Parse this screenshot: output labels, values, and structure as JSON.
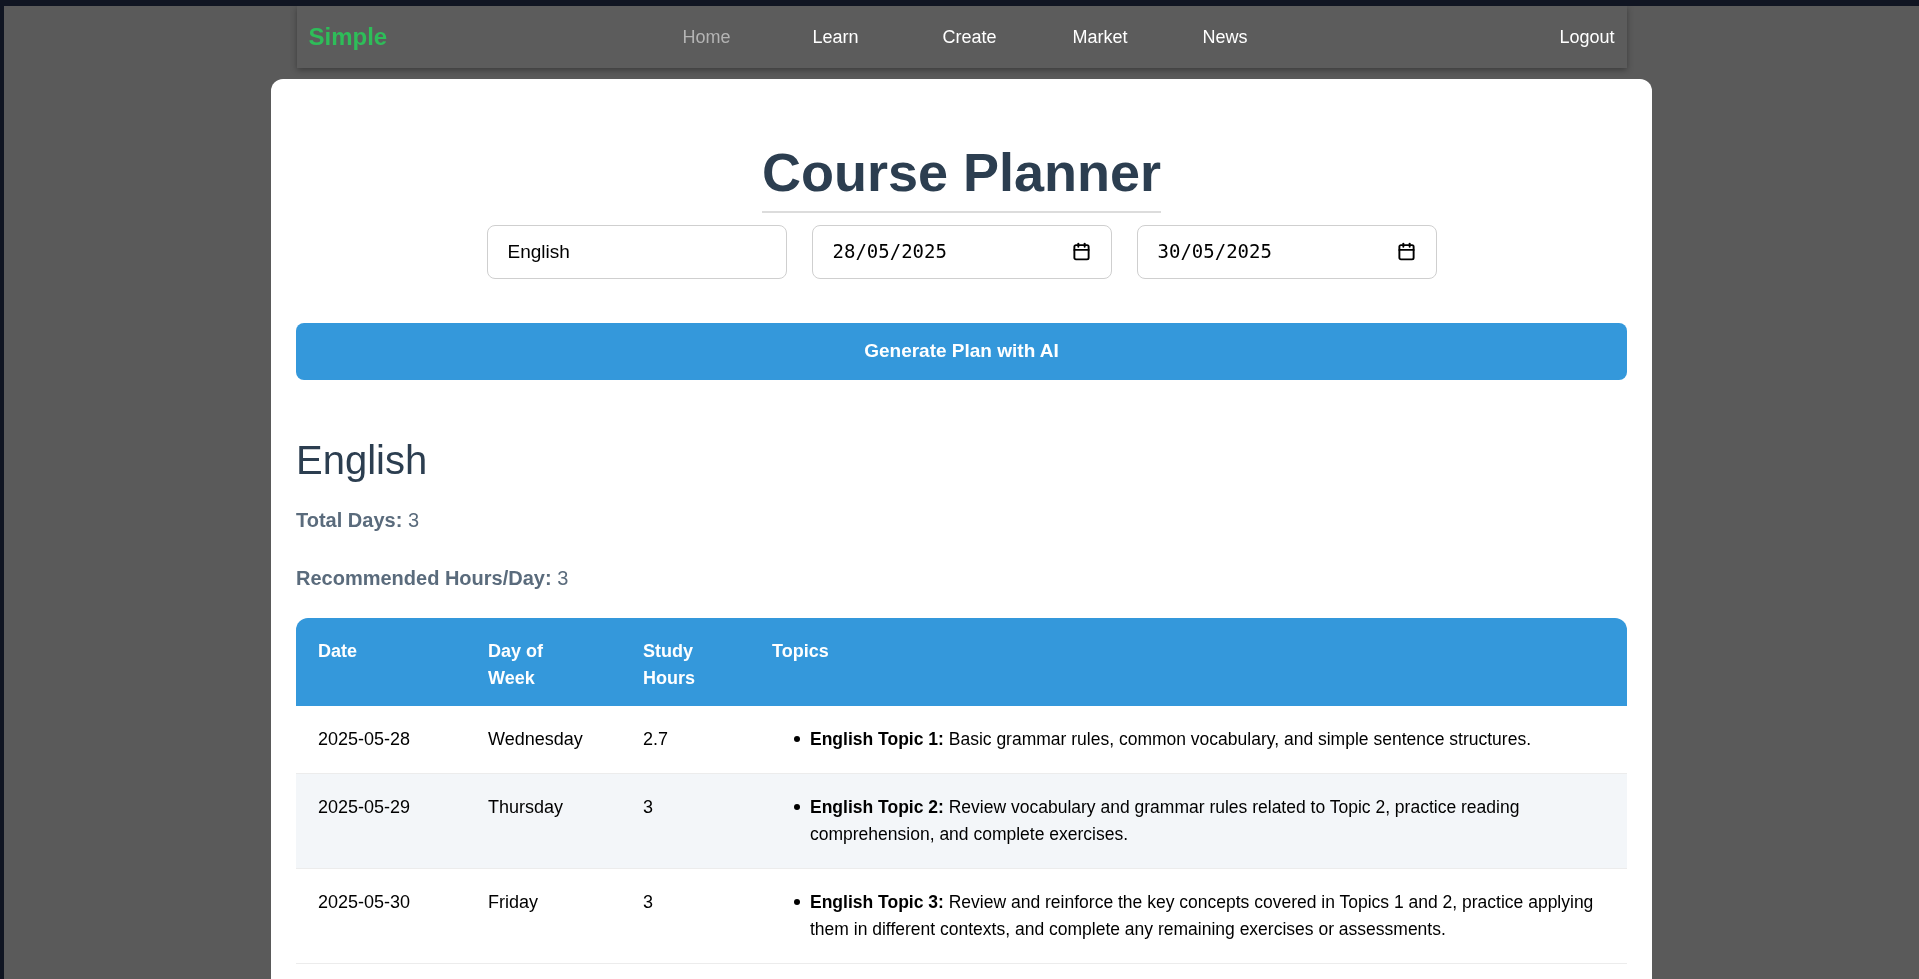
{
  "navbar": {
    "logo": "Simple",
    "links": [
      {
        "label": "Home",
        "selected": true
      },
      {
        "label": "Learn",
        "selected": false
      },
      {
        "label": "Create",
        "selected": false
      },
      {
        "label": "Market",
        "selected": false
      },
      {
        "label": "News",
        "selected": false
      }
    ],
    "logout": "Logout"
  },
  "title": "Course Planner",
  "form": {
    "subject": "English",
    "start_date": "28/05/2025",
    "end_date": "30/05/2025",
    "button": "Generate Plan with AI"
  },
  "plan": {
    "heading": "English",
    "stats": [
      {
        "label": "Total Days:",
        "value": "3"
      },
      {
        "label": "Recommended Hours/Day:",
        "value": "3"
      }
    ],
    "table": {
      "columns": [
        "Date",
        "Day of Week",
        "Study Hours",
        "Topics"
      ],
      "rows": [
        {
          "date": "2025-05-28",
          "day": "Wednesday",
          "hours": "2.7",
          "topics": [
            "**English Topic 1:** Basic grammar rules, common vocabulary, and simple sentence structures."
          ]
        },
        {
          "date": "2025-05-29",
          "day": "Thursday",
          "hours": "3",
          "topics": [
            "**English Topic 2:** Review vocabulary and grammar rules related to Topic 2, practice reading comprehension, and complete exercises."
          ]
        },
        {
          "date": "2025-05-30",
          "day": "Friday",
          "hours": "3",
          "topics": [
            "**English Topic 3:** Review and reinforce the key concepts covered in Topics 1 and 2, practice applying them in different contexts, and complete any remaining exercises or assessments."
          ]
        }
      ]
    }
  }
}
